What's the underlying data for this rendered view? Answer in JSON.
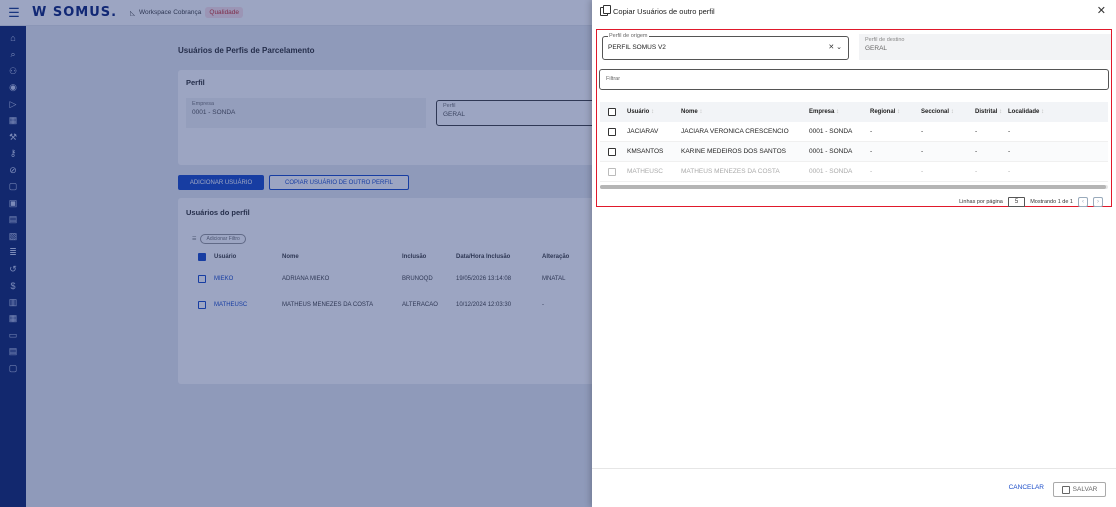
{
  "app": {
    "logo": "W SOMUS.",
    "workspace": "Workspace Cobrança",
    "env_badge": "Qualidade"
  },
  "page": {
    "title": "Usuários de Perfis de Parcelamento",
    "perfil_card_title": "Perfil",
    "empresa_label": "Empresa",
    "empresa_value": "0001 - SONDA",
    "perfil_label": "Perfil",
    "perfil_value": "GERAL",
    "add_user_button": "ADICIONAR USUÁRIO",
    "copy_button": "COPIAR USUÁRIO DE OUTRO PERFIL",
    "users_title": "Usuários do perfil",
    "add_filter": "Adicionar Filtro",
    "columns": [
      "Usuário",
      "Nome",
      "Inclusão",
      "Data/Hora Inclusão",
      "Alteração"
    ],
    "rows": [
      {
        "user": "MIEKO",
        "name": "ADRIANA MIEKO",
        "inclusao": "BRUNOQD",
        "datahora": "19/05/2026 13:14:08",
        "alteracao": "MNATAL"
      },
      {
        "user": "MATHEUSC",
        "name": "MATHEUS MENEZES DA COSTA",
        "inclusao": "ALTERACAO",
        "datahora": "10/12/2024 12:03:30",
        "alteracao": "-"
      }
    ]
  },
  "dialog": {
    "title": "Copiar Usuários de outro perfil",
    "origem_label": "Perfil de origem",
    "origem_value": "PERFIL SOMUS V2",
    "destino_label": "Perfil de destino",
    "destino_value": "GERAL",
    "filter_placeholder": "Filtrar",
    "columns": [
      "Usuário",
      "Nome",
      "Empresa",
      "Regional",
      "Seccional",
      "Distrital",
      "Localidade"
    ],
    "rows": [
      {
        "user": "JACIARAV",
        "name": "JACIARA VERONICA CRESCENCIO",
        "empresa": "0001 - SONDA",
        "regional": "-",
        "seccional": "-",
        "distrital": "-",
        "localidade": "-"
      },
      {
        "user": "KMSANTOS",
        "name": "KARINE MEDEIROS DOS SANTOS",
        "empresa": "0001 - SONDA",
        "regional": "-",
        "seccional": "-",
        "distrital": "-",
        "localidade": "-"
      },
      {
        "user": "MATHEUSC",
        "name": "MATHEUS MENEZES DA COSTA",
        "empresa": "0001 - SONDA",
        "regional": "-",
        "seccional": "-",
        "distrital": "-",
        "localidade": "-"
      }
    ],
    "rows_per_page_label": "Linhas por página",
    "rows_per_page": "5",
    "showing": "Mostrando 1 de 1",
    "cancel": "CANCELAR",
    "save": "SALVAR"
  },
  "colors": {
    "brand": "#12296e",
    "accent": "#1a4cc9",
    "highlight": "#e0192b"
  }
}
